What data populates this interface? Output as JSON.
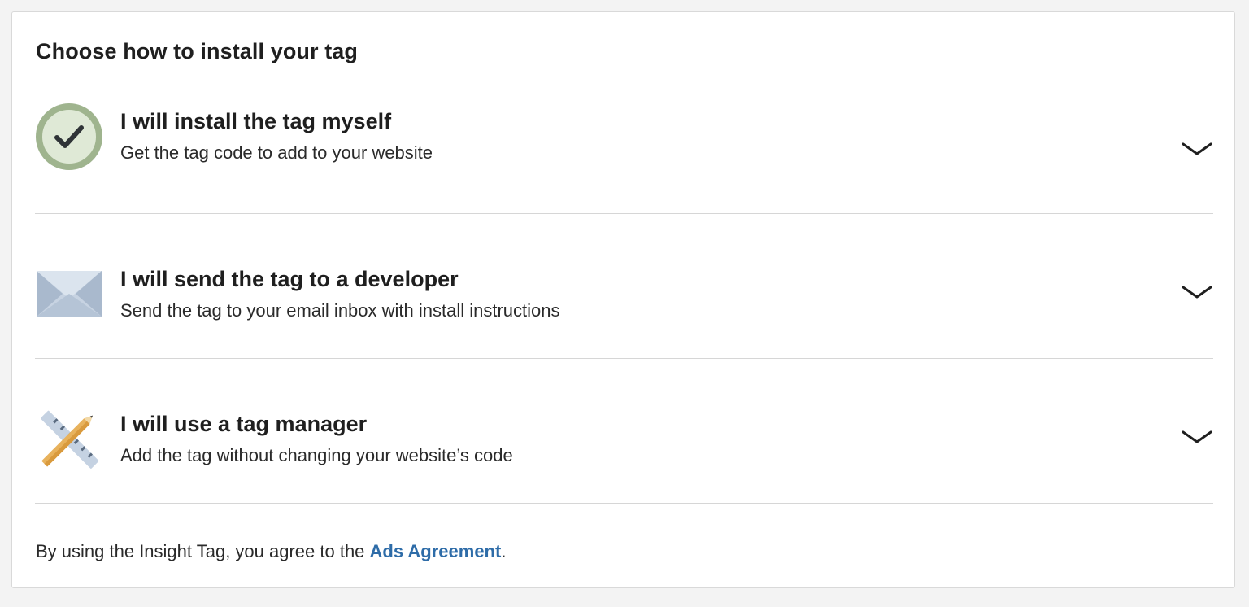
{
  "heading": "Choose how to install your tag",
  "options": [
    {
      "title": "I will install the tag myself",
      "description": "Get the tag code to add to your website",
      "icon": "checkmark-circle-icon",
      "selected": true
    },
    {
      "title": "I will send the tag to a developer",
      "description": "Send the tag to your email inbox with install instructions",
      "icon": "envelope-icon"
    },
    {
      "title": "I will use a tag manager",
      "description": "Add the tag without changing your website’s code",
      "icon": "ruler-pencil-icon"
    }
  ],
  "footer": {
    "prefix": "By using the Insight Tag, you agree to the ",
    "link_label": "Ads Agreement",
    "suffix": "."
  },
  "colors": {
    "link": "#2e6ca8",
    "check_ring": "#9fb48e",
    "check_fill": "#dfe9d6",
    "envelope": "#c7d3e2"
  }
}
